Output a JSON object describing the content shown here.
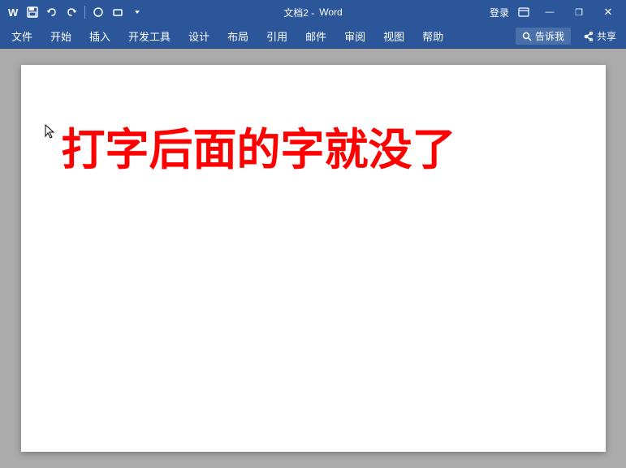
{
  "titlebar": {
    "document_name": "文档2 - ",
    "app_name": "Word",
    "signin_label": "登录",
    "qa_icons": [
      "save",
      "undo",
      "redo",
      "circle",
      "rectangle",
      "dropdown"
    ]
  },
  "menubar": {
    "items": [
      {
        "id": "file",
        "label": "文件"
      },
      {
        "id": "home",
        "label": "开始"
      },
      {
        "id": "insert",
        "label": "插入"
      },
      {
        "id": "developer",
        "label": "开发工具"
      },
      {
        "id": "design",
        "label": "设计"
      },
      {
        "id": "layout",
        "label": "布局"
      },
      {
        "id": "references",
        "label": "引用"
      },
      {
        "id": "mailings",
        "label": "邮件"
      },
      {
        "id": "review",
        "label": "审阅"
      },
      {
        "id": "view",
        "label": "视图"
      },
      {
        "id": "help",
        "label": "帮助"
      }
    ],
    "search_placeholder": "告诉我",
    "share_label": "共享"
  },
  "document": {
    "content": "打字后面的字就没了"
  },
  "window_controls": {
    "minimize": "—",
    "restore": "❐",
    "close": "✕"
  }
}
